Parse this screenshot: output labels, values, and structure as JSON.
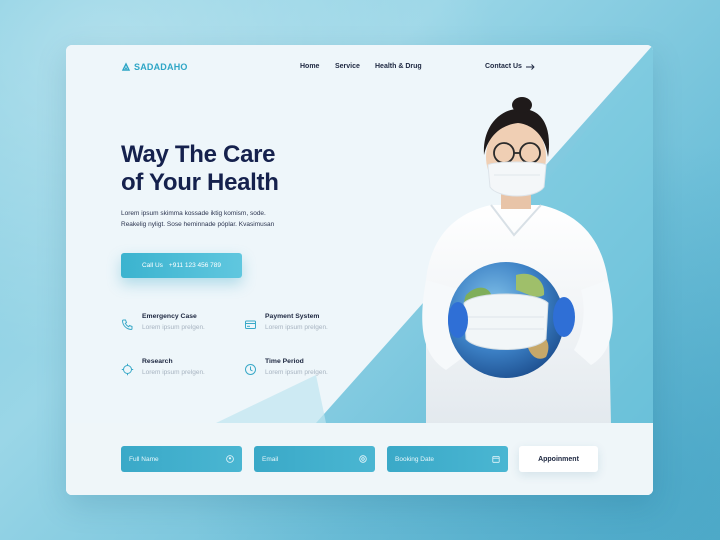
{
  "brand": {
    "name": "SADADAHO"
  },
  "nav": {
    "links": [
      "Home",
      "Service",
      "Health & Drug"
    ],
    "contact_label": "Contact Us"
  },
  "hero": {
    "title_line1": "Way The Care",
    "title_line2": "of Your Health",
    "desc_line1": "Lorem ipsum skimma kossade iktig komism, sode.",
    "desc_line2": "Reakelig nyligt. Sose heminnade póplar. Kvasimusan",
    "call_label": "Call Us",
    "call_number": "+911 123 456 789"
  },
  "features": [
    {
      "title": "Emergency Case",
      "subtitle": "Lorem ipsum prelgen.",
      "icon": "phone-icon"
    },
    {
      "title": "Payment System",
      "subtitle": "Lorem ipsum prelgen.",
      "icon": "card-icon"
    },
    {
      "title": "Research",
      "subtitle": "Lorem ipsum prelgen.",
      "icon": "target-icon"
    },
    {
      "title": "Time Period",
      "subtitle": "Lorem ipsum prelgen.",
      "icon": "clock-icon"
    }
  ],
  "form": {
    "full_name": "Full Name",
    "email": "Email",
    "booking_date": "Booking Date",
    "submit": "Appoinment"
  },
  "colors": {
    "accent": "#3bb3cf",
    "title": "#15214d",
    "background": "#7fcbe0"
  }
}
